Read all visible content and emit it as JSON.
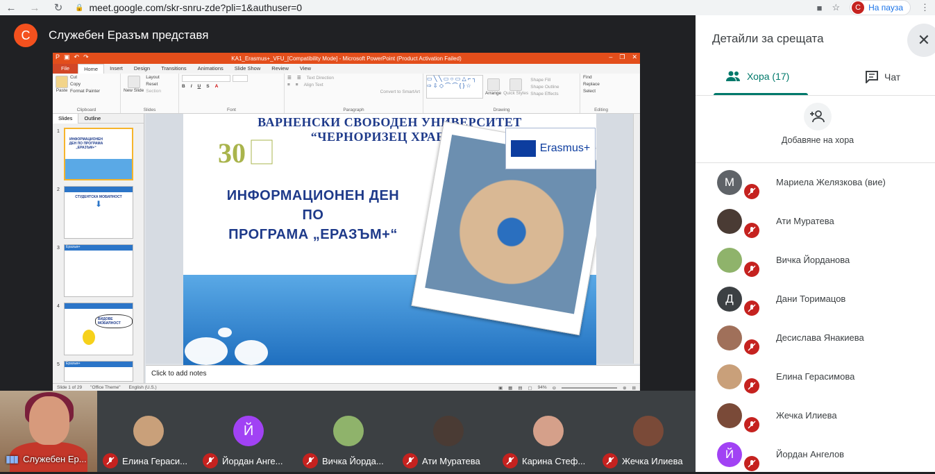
{
  "browser": {
    "url": "meet.google.com/skr-snru-zde?pli=1&authuser=0",
    "profile_initial": "C",
    "profile_status": "На пауза"
  },
  "meeting": {
    "presenter_initial": "С",
    "presenter_title": "Служебен Еразъм представя"
  },
  "powerpoint": {
    "window_title": "KA1_Erasmus+_VFU_[Compatibility Mode] - Microsoft PowerPoint (Product Activation Failed)",
    "tabs": [
      "File",
      "Home",
      "Insert",
      "Design",
      "Transitions",
      "Animations",
      "Slide Show",
      "Review",
      "View"
    ],
    "active_tab": "Home",
    "ribbon": {
      "clipboard": [
        "Paste",
        "Cut",
        "Copy",
        "Format Painter"
      ],
      "clipboard_label": "Clipboard",
      "slides": [
        "New Slide",
        "Layout",
        "Reset",
        "Section"
      ],
      "slides_label": "Slides",
      "font_label": "Font",
      "paragraph": [
        "Text Direction",
        "Align Text",
        "Convert to SmartArt"
      ],
      "paragraph_label": "Paragraph",
      "drawing": [
        "Arrange",
        "Quick Styles",
        "Shape Fill",
        "Shape Outline",
        "Shape Effects"
      ],
      "drawing_label": "Drawing",
      "editing": [
        "Find",
        "Replace",
        "Select"
      ],
      "editing_label": "Editing"
    },
    "pane_tabs": [
      "Slides",
      "Outline"
    ],
    "thumbnails": [
      {
        "num": "1",
        "title": "ИНФОРМАЦИОНЕН ДЕН ПО ПРОГРАМА „ЕРАЗЪМ+“"
      },
      {
        "num": "2",
        "title": "СТУДЕНТСКА МОБИЛНОСТ"
      },
      {
        "num": "3",
        "title": "Еразъм+"
      },
      {
        "num": "4",
        "title": "ВИДОВЕ МОБИЛНОСТ"
      },
      {
        "num": "5",
        "title": "Еразъм+"
      }
    ],
    "slide": {
      "university_line1": "ВАРНЕНСКИ СВОБОДЕН УНИВЕРСИТЕТ",
      "university_line2": "“ЧЕРНОРИЗЕЦ ХРАБЪР”",
      "info_line1": "ИНФОРМАЦИОНЕН ДЕН",
      "info_line2": "ПО",
      "info_line3": "ПРОГРАМА „ЕРАЗЪМ+“",
      "erasmus_logo_text": "Erasmus+"
    },
    "notes_placeholder": "Click to add notes",
    "status": {
      "slide_of": "Slide 1 of 29",
      "theme": "\"Office Theme\"",
      "language": "English (U.S.)",
      "zoom": "94%"
    }
  },
  "participants_strip": [
    {
      "name": "Служебен Ер...",
      "type": "self"
    },
    {
      "name": "Елина Гераси...",
      "avatar": "photo",
      "color": "#c9a07a"
    },
    {
      "name": "Йордан Анге...",
      "avatar": "Й",
      "color": "#a142f4"
    },
    {
      "name": "Вичка Йорда...",
      "avatar": "photo",
      "color": "#8fb36b"
    },
    {
      "name": "Ати Муратева",
      "avatar": "photo",
      "color": "#4a3b34"
    },
    {
      "name": "Карина Стеф...",
      "avatar": "photo",
      "color": "#d5a08a"
    },
    {
      "name": "Жечка Илиева",
      "avatar": "photo",
      "color": "#7a4a38"
    }
  ],
  "panel": {
    "title": "Детайли за срещата",
    "tab_people": "Хора (17)",
    "tab_chat": "Чат",
    "add_people": "Добавяне на хора",
    "people": [
      {
        "name": "Мариела Желязкова (вие)",
        "initial": "М",
        "color": "#5f6368"
      },
      {
        "name": "Ати Муратева",
        "initial": "",
        "color": "#4a3b34"
      },
      {
        "name": "Вичка Йорданова",
        "initial": "",
        "color": "#8fb36b"
      },
      {
        "name": "Дани Торимацов",
        "initial": "Д",
        "color": "#3c4043"
      },
      {
        "name": "Десислава Янакиева",
        "initial": "",
        "color": "#a0705a"
      },
      {
        "name": "Елина Герасимова",
        "initial": "",
        "color": "#c9a07a"
      },
      {
        "name": "Жечка Илиева",
        "initial": "",
        "color": "#7a4a38"
      },
      {
        "name": "Йордан Ангелов",
        "initial": "Й",
        "color": "#a142f4"
      }
    ]
  }
}
